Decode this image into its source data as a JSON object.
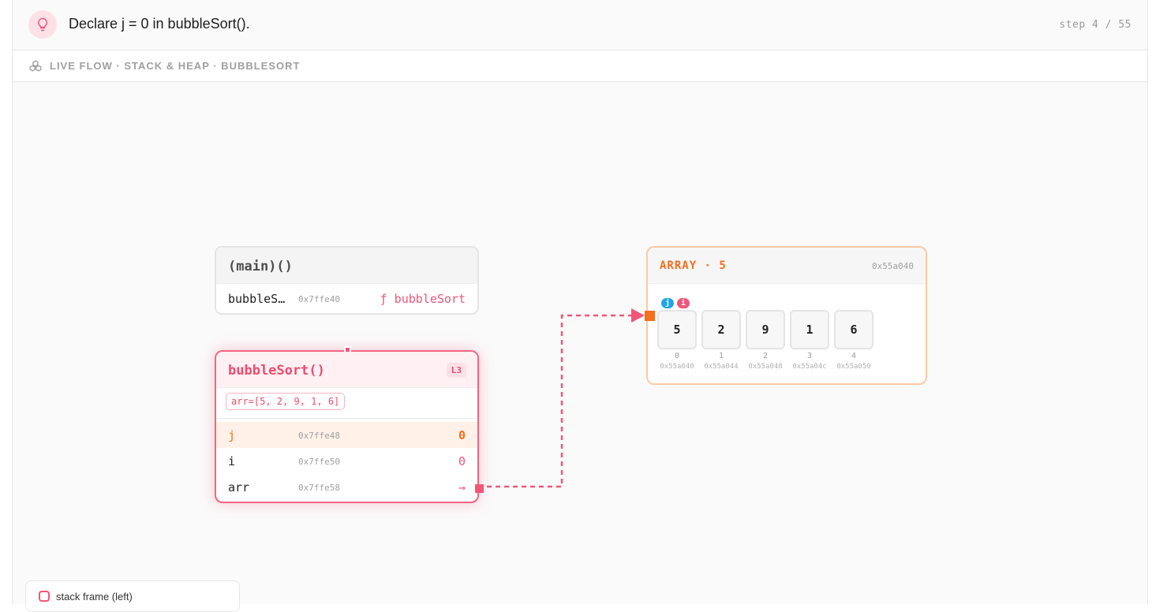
{
  "header": {
    "icon": "lightbulb-icon",
    "title": "Declare j = 0 in bubbleSort().",
    "step_counter": "step 4 / 55"
  },
  "subheader": {
    "icon": "cubes-icon",
    "breadcrumb": "LIVE FLOW · STACK & HEAP · BUBBLESORT"
  },
  "main_frame": {
    "title": "(main)()",
    "rows": [
      {
        "name": "bubbleS…",
        "addr": "0x7ffe40",
        "value": "ƒ bubbleSort"
      }
    ]
  },
  "bubblesort_frame": {
    "title": "bubbleSort()",
    "line": "L3",
    "args": "arr=[5, 2, 9, 1, 6]",
    "rows": [
      {
        "name": "j",
        "addr": "0x7ffe48",
        "value": "0",
        "active": true
      },
      {
        "name": "i",
        "addr": "0x7ffe50",
        "value": "0"
      },
      {
        "name": "arr",
        "addr": "0x7ffe58",
        "value": "→"
      }
    ]
  },
  "array": {
    "title": "ARRAY · 5",
    "addr": "0x55a040",
    "tags": [
      "j",
      "i"
    ],
    "cells": [
      {
        "value": "5",
        "index": "0",
        "addr": "0x55a040"
      },
      {
        "value": "2",
        "index": "1",
        "addr": "0x55a044"
      },
      {
        "value": "9",
        "index": "2",
        "addr": "0x55a048"
      },
      {
        "value": "1",
        "index": "3",
        "addr": "0x55a04c"
      },
      {
        "value": "6",
        "index": "4",
        "addr": "0x55a050"
      }
    ]
  },
  "legend": {
    "label": "stack frame (left)"
  },
  "colors": {
    "accent_pink": "#f2557a",
    "accent_orange": "#f76e1c",
    "accent_blue": "#1ea5e9"
  }
}
